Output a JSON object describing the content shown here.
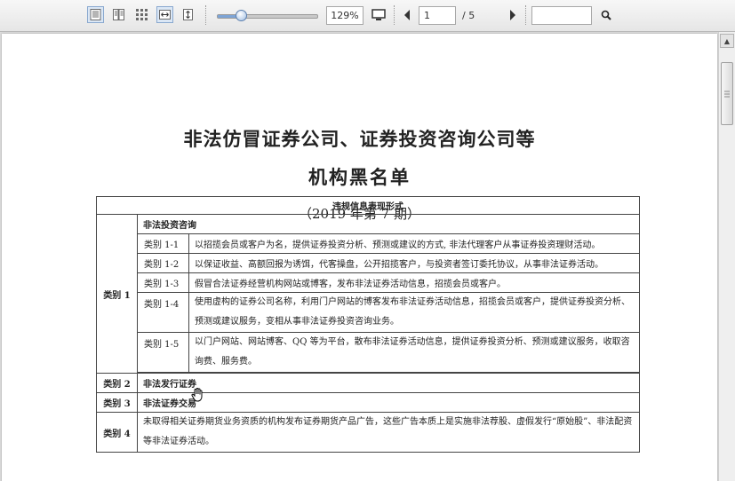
{
  "toolbar": {
    "view_buttons": [
      {
        "name": "single-page-view-icon",
        "active": true
      },
      {
        "name": "two-page-view-icon",
        "active": false
      },
      {
        "name": "thumbnail-grid-icon",
        "active": false
      },
      {
        "name": "fit-width-icon",
        "active": false
      },
      {
        "name": "fit-height-icon",
        "active": false
      }
    ],
    "zoom": {
      "slider_fraction": 0.24,
      "value": "129%"
    },
    "page": {
      "current": "1",
      "separator": "/ 5"
    },
    "search": {
      "value": ""
    }
  },
  "document": {
    "title_line1": "非法仿冒证券公司、证券投资咨询公司等",
    "title_line2": "机构黑名单",
    "issue": "（2019 年第 7 期）",
    "table": {
      "header": "违规信息表现形式",
      "category1": {
        "label": "类别 1",
        "subheading": "非法投资咨询",
        "rows": [
          {
            "code": "类别 1-1",
            "text": "以招揽会员或客户为名，提供证券投资分析、预测或建议的方式, 非法代理客户从事证券投资理财活动。"
          },
          {
            "code": "类别 1-2",
            "text": "以保证收益、高额回报为诱饵，代客操盘，公开招揽客户，与投资者签订委托协议，从事非法证券活动。"
          },
          {
            "code": "类别 1-3",
            "text": "假冒合法证券经营机构网站或博客，发布非法证券活动信息，招揽会员或客户。"
          },
          {
            "code": "类别 1-4",
            "text": "使用虚构的证券公司名称，利用门户网站的博客发布非法证券活动信息，招揽会员或客户，提供证券投资分析、预测或建议服务，变相从事非法证券投资咨询业务。"
          },
          {
            "code": "类别 1-5",
            "text": "以门户网站、网站博客、QQ 等为平台，散布非法证券活动信息，提供证券投资分析、预测或建议服务，收取咨询费、服务费。"
          }
        ]
      },
      "category2": {
        "label": "类别 2",
        "text": "非法发行证券"
      },
      "category3": {
        "label": "类别 3",
        "text": "非法证券交易"
      },
      "category4": {
        "label": "类别 4",
        "text": "未取得相关证券期货业务资质的机构发布证券期货产品广告，这些广告本质上是实施非法荐股、虚假发行“原始股”、非法配资等非法证券活动。"
      }
    }
  }
}
